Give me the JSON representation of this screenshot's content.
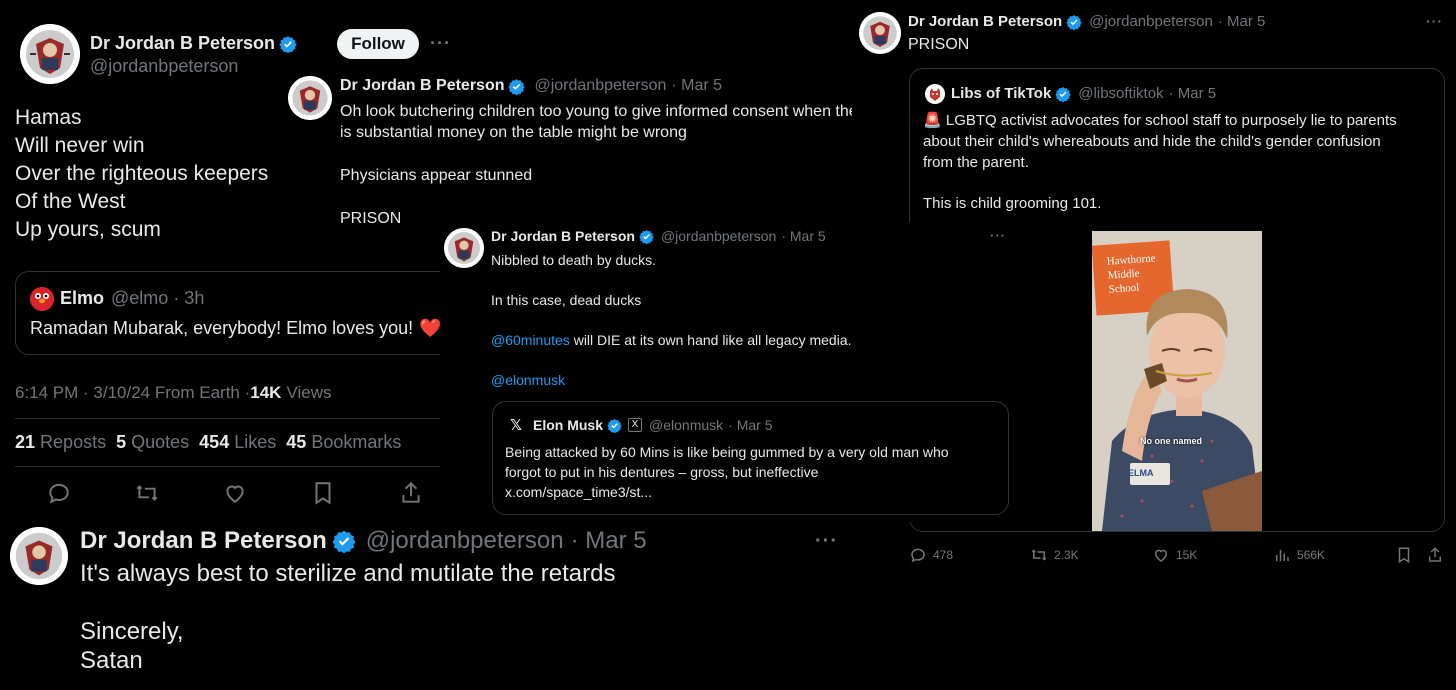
{
  "panel_a": {
    "name": "Dr Jordan B Peterson",
    "handle": "@jordanbpeterson",
    "follow_label": "Follow",
    "lines": [
      "Hamas",
      "Will never win",
      "Over the righteous keepers",
      "Of the West",
      "Up yours, scum"
    ],
    "quote": {
      "name": "Elmo",
      "handle": "@elmo",
      "time": "· 3h",
      "text": "Ramadan Mubarak, everybody! Elmo loves you!",
      "emoji": "❤️"
    },
    "meta": "6:14 PM · 3/10/24 From Earth · ",
    "views_count": "14K",
    "views_label": "Views",
    "stats": [
      {
        "count": "21",
        "label": "Reposts"
      },
      {
        "count": "5",
        "label": "Quotes"
      },
      {
        "count": "454",
        "label": "Likes"
      },
      {
        "count": "45",
        "label": "Bookmarks"
      }
    ]
  },
  "panel_b": {
    "name": "Dr Jordan B Peterson",
    "handle": "@jordanbpeterson",
    "time": "· Mar 5",
    "line1": "Oh look butchering children too young to give informed consent when there",
    "line2": "is substantial money on the table might be wrong",
    "line3": "Physicians appear stunned",
    "line4": "PRISON"
  },
  "panel_c": {
    "name": "Dr Jordan B Peterson",
    "handle": "@jordanbpeterson",
    "time": "· Mar 5",
    "text": "PRISON",
    "quote": {
      "name": "Libs of TikTok",
      "handle": "@libsoftiktok",
      "time": "· Mar 5",
      "emoji": "🚨",
      "line1": "LGBTQ activist advocates for school staff to purposely lie to parents",
      "line2": "about their child's whereabouts and hide the child's gender confusion",
      "line3": "from the parent.",
      "line4": "This is child grooming 101."
    },
    "video": {
      "sign1": "Hawthorne",
      "sign2": "Middle",
      "sign3": "School",
      "caption": "No one named",
      "badge": "ELMA"
    },
    "actions": {
      "replies": "478",
      "reposts": "2.3K",
      "likes": "15K",
      "views": "566K"
    }
  },
  "panel_d": {
    "name": "Dr Jordan B Peterson",
    "handle": "@jordanbpeterson",
    "time": "· Mar 5",
    "line1": "Nibbled to death by ducks.",
    "line2": "In this case, dead ducks",
    "mention1": "@60minutes",
    "line3": " will DIE at its own hand like all legacy media.",
    "mention2": "@elonmusk",
    "quote": {
      "name": "Elon Musk",
      "handle": "@elonmusk",
      "time": "· Mar 5",
      "line1": "Being attacked by 60 Mins is like being gummed by a very old man who",
      "line2": "forgot to put in his dentures – gross, but ineffective",
      "line3": "x.com/space_time3/st..."
    }
  },
  "panel_e": {
    "name": "Dr Jordan B Peterson",
    "handle": "@jordanbpeterson",
    "time": "· Mar 5",
    "line1": "It's always best to sterilize and mutilate the retards",
    "line2": "Sincerely,",
    "line3": "Satan"
  },
  "colors": {
    "background": "#000000",
    "text": "#e7e9ea",
    "muted": "#71767b",
    "link": "#1d9bf0",
    "verified": "#1d9bf0",
    "border": "#2f3336"
  }
}
